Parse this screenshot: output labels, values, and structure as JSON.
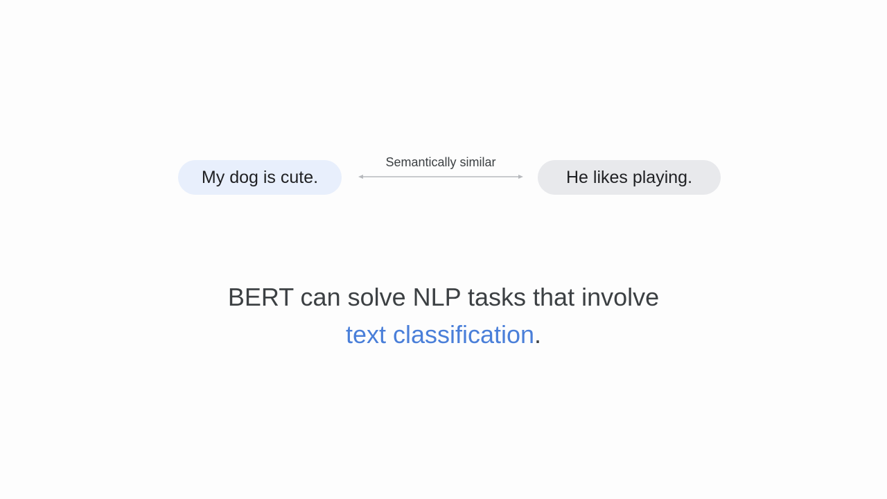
{
  "diagram": {
    "left_sentence": "My dog is cute.",
    "right_sentence": "He likes playing.",
    "relation_label": "Semantically similar"
  },
  "caption": {
    "line1": "BERT can solve NLP tasks that involve",
    "highlight": "text classification",
    "end_punct": "."
  },
  "colors": {
    "left_pill": "#e8effc",
    "right_pill": "#e8e9ec",
    "highlight": "#4a7fd9",
    "text": "#3c4043"
  }
}
